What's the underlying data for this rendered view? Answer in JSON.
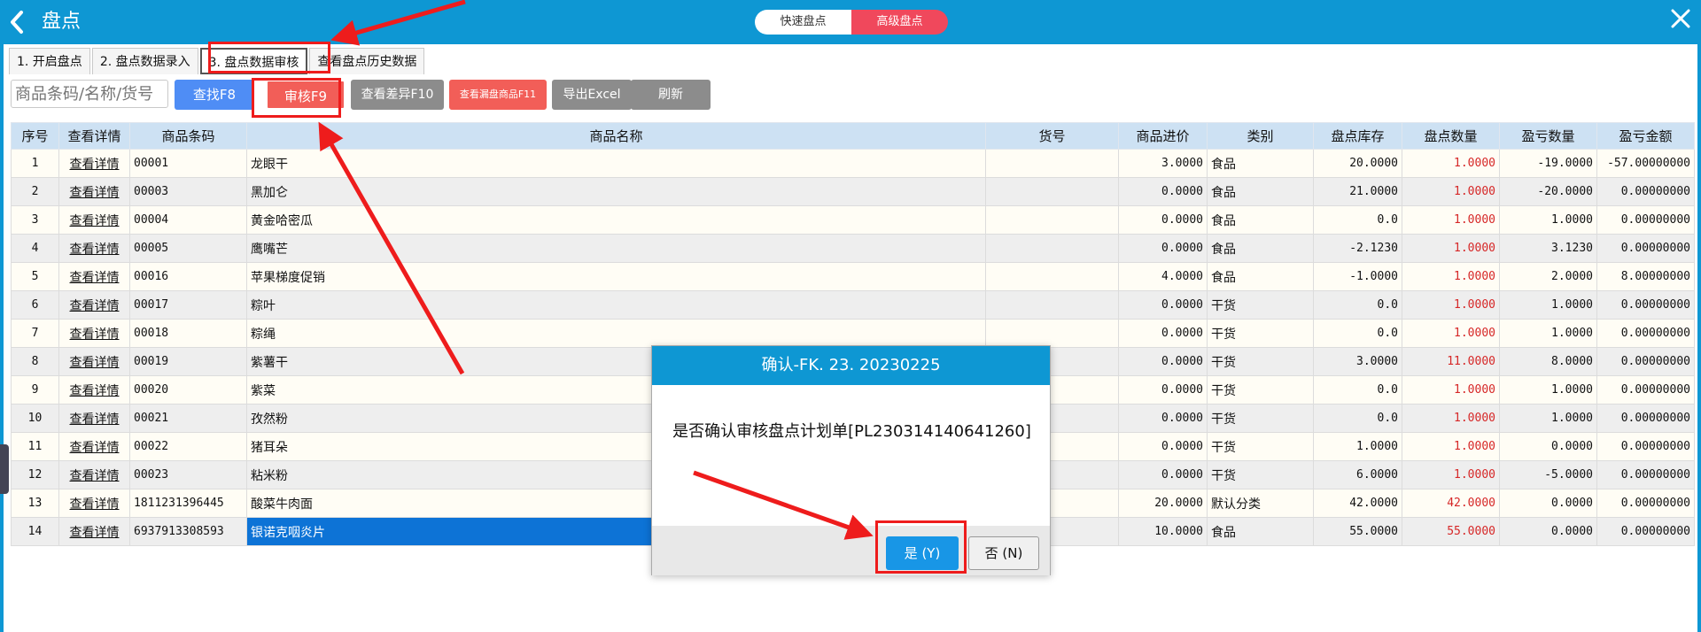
{
  "header": {
    "title": "盘点",
    "modes": [
      "快速盘点",
      "高级盘点"
    ],
    "active_mode": "高级盘点"
  },
  "tabs": [
    {
      "label": "1. 开启盘点"
    },
    {
      "label": "2. 盘点数据录入"
    },
    {
      "label": "3. 盘点数据审核"
    },
    {
      "label": "查看盘点历史数据"
    }
  ],
  "toolbar": {
    "search_placeholder": "商品条码/名称/货号",
    "find_label": "查找F8",
    "audit_label": "审核F9",
    "diff_label": "查看差异F10",
    "missing_label": "查看漏盘商品F11",
    "export_label": "导出Excel",
    "refresh_label": "刷新"
  },
  "table": {
    "columns": [
      "序号",
      "查看详情",
      "商品条码",
      "商品名称",
      "货号",
      "商品进价",
      "类别",
      "盘点库存",
      "盘点数量",
      "盈亏数量",
      "盈亏金额"
    ],
    "rows": [
      {
        "no": "1",
        "detail": "查看详情",
        "barcode": "00001",
        "name": "龙眼干",
        "sku": "",
        "price": "3.0000",
        "category": "食品",
        "stock": "20.0000",
        "count": "1.0000",
        "diff": "-19.0000",
        "amount": "-57.00000000"
      },
      {
        "no": "2",
        "detail": "查看详情",
        "barcode": "00003",
        "name": "黑加仑",
        "sku": "",
        "price": "0.0000",
        "category": "食品",
        "stock": "21.0000",
        "count": "1.0000",
        "diff": "-20.0000",
        "amount": "0.00000000"
      },
      {
        "no": "3",
        "detail": "查看详情",
        "barcode": "00004",
        "name": "黄金哈密瓜",
        "sku": "",
        "price": "0.0000",
        "category": "食品",
        "stock": "0.0",
        "count": "1.0000",
        "diff": "1.0000",
        "amount": "0.00000000"
      },
      {
        "no": "4",
        "detail": "查看详情",
        "barcode": "00005",
        "name": "鹰嘴芒",
        "sku": "",
        "price": "0.0000",
        "category": "食品",
        "stock": "-2.1230",
        "count": "1.0000",
        "diff": "3.1230",
        "amount": "0.00000000"
      },
      {
        "no": "5",
        "detail": "查看详情",
        "barcode": "00016",
        "name": "苹果梯度促销",
        "sku": "",
        "price": "4.0000",
        "category": "食品",
        "stock": "-1.0000",
        "count": "1.0000",
        "diff": "2.0000",
        "amount": "8.00000000"
      },
      {
        "no": "6",
        "detail": "查看详情",
        "barcode": "00017",
        "name": "粽叶",
        "sku": "",
        "price": "0.0000",
        "category": "干货",
        "stock": "0.0",
        "count": "1.0000",
        "diff": "1.0000",
        "amount": "0.00000000"
      },
      {
        "no": "7",
        "detail": "查看详情",
        "barcode": "00018",
        "name": "粽绳",
        "sku": "",
        "price": "0.0000",
        "category": "干货",
        "stock": "0.0",
        "count": "1.0000",
        "diff": "1.0000",
        "amount": "0.00000000"
      },
      {
        "no": "8",
        "detail": "查看详情",
        "barcode": "00019",
        "name": "紫薯干",
        "sku": "",
        "price": "0.0000",
        "category": "干货",
        "stock": "3.0000",
        "count": "11.0000",
        "diff": "8.0000",
        "amount": "0.00000000"
      },
      {
        "no": "9",
        "detail": "查看详情",
        "barcode": "00020",
        "name": "紫菜",
        "sku": "",
        "price": "0.0000",
        "category": "干货",
        "stock": "0.0",
        "count": "1.0000",
        "diff": "1.0000",
        "amount": "0.00000000"
      },
      {
        "no": "10",
        "detail": "查看详情",
        "barcode": "00021",
        "name": "孜然粉",
        "sku": "",
        "price": "0.0000",
        "category": "干货",
        "stock": "0.0",
        "count": "1.0000",
        "diff": "1.0000",
        "amount": "0.00000000"
      },
      {
        "no": "11",
        "detail": "查看详情",
        "barcode": "00022",
        "name": "猪耳朵",
        "sku": "",
        "price": "0.0000",
        "category": "干货",
        "stock": "1.0000",
        "count": "1.0000",
        "diff": "0.0000",
        "amount": "0.00000000"
      },
      {
        "no": "12",
        "detail": "查看详情",
        "barcode": "00023",
        "name": "粘米粉",
        "sku": "",
        "price": "0.0000",
        "category": "干货",
        "stock": "6.0000",
        "count": "1.0000",
        "diff": "-5.0000",
        "amount": "0.00000000"
      },
      {
        "no": "13",
        "detail": "查看详情",
        "barcode": "1811231396445",
        "name": "酸菜牛肉面",
        "sku": "",
        "price": "20.0000",
        "category": "默认分类",
        "stock": "42.0000",
        "count": "42.0000",
        "diff": "0.0000",
        "amount": "0.00000000"
      },
      {
        "no": "14",
        "detail": "查看详情",
        "barcode": "6937913308593",
        "name": "银诺克咽炎片",
        "sku": "",
        "price": "10.0000",
        "category": "食品",
        "stock": "55.0000",
        "count": "55.0000",
        "diff": "0.0000",
        "amount": "0.00000000"
      }
    ],
    "selected_row": "14"
  },
  "dialog": {
    "title": "确认-FK. 23. 20230225",
    "message": "是否确认审核盘点计划单[PL230314140641260]",
    "yes_label": "是 (Y)",
    "no_label": "否 (N)"
  },
  "colors": {
    "header_bg": "#0e97d3",
    "accent_red": "#f25e58",
    "annotation_red": "#ee1c1c",
    "selection_blue": "#0d73d6"
  }
}
